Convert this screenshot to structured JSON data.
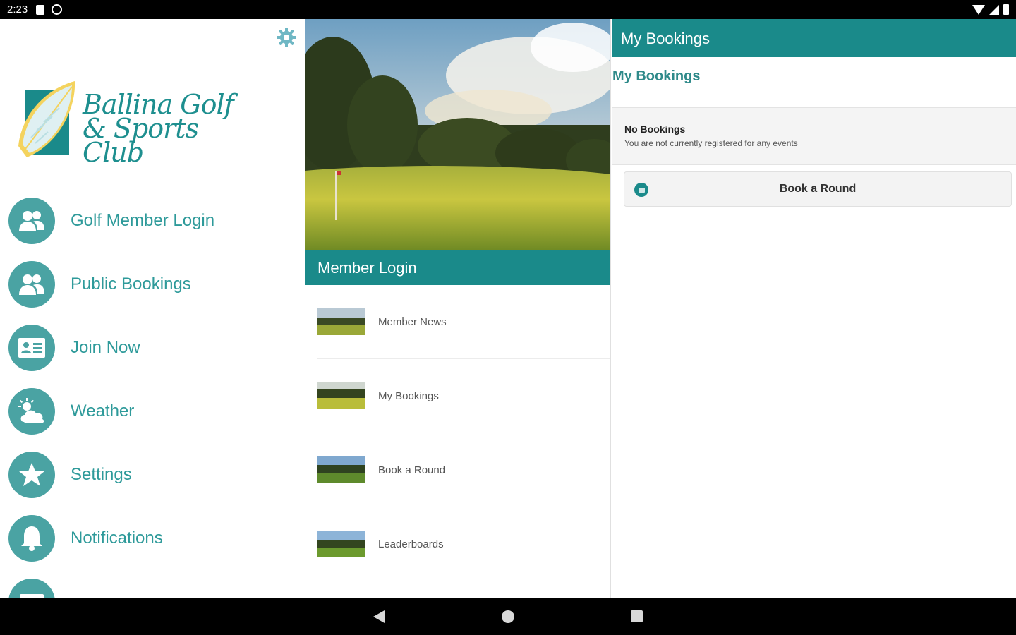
{
  "status_bar": {
    "time": "2:23"
  },
  "brand": {
    "line1": "Ballina Golf",
    "line2": "& Sports Club",
    "color": "#1e8f8f"
  },
  "drawer": {
    "items": [
      {
        "label": "Golf Member Login",
        "icon": "members-icon"
      },
      {
        "label": "Public Bookings",
        "icon": "members-icon"
      },
      {
        "label": "Join Now",
        "icon": "id-card-icon"
      },
      {
        "label": "Weather",
        "icon": "weather-icon"
      },
      {
        "label": "Settings",
        "icon": "star-icon"
      },
      {
        "label": "Notifications",
        "icon": "bell-icon"
      }
    ]
  },
  "middle": {
    "section_title": "Member Login",
    "list": [
      {
        "label": "Member News"
      },
      {
        "label": "My Bookings"
      },
      {
        "label": "Book a Round"
      },
      {
        "label": "Leaderboards"
      }
    ]
  },
  "right": {
    "header_title": "My Bookings",
    "subtitle": "My Bookings",
    "empty_title": "No Bookings",
    "empty_desc": "You are not currently registered for any events",
    "book_button": "Book a Round"
  },
  "colors": {
    "accent": "#1a8a8a",
    "icon_circle": "#4aa3a3"
  }
}
